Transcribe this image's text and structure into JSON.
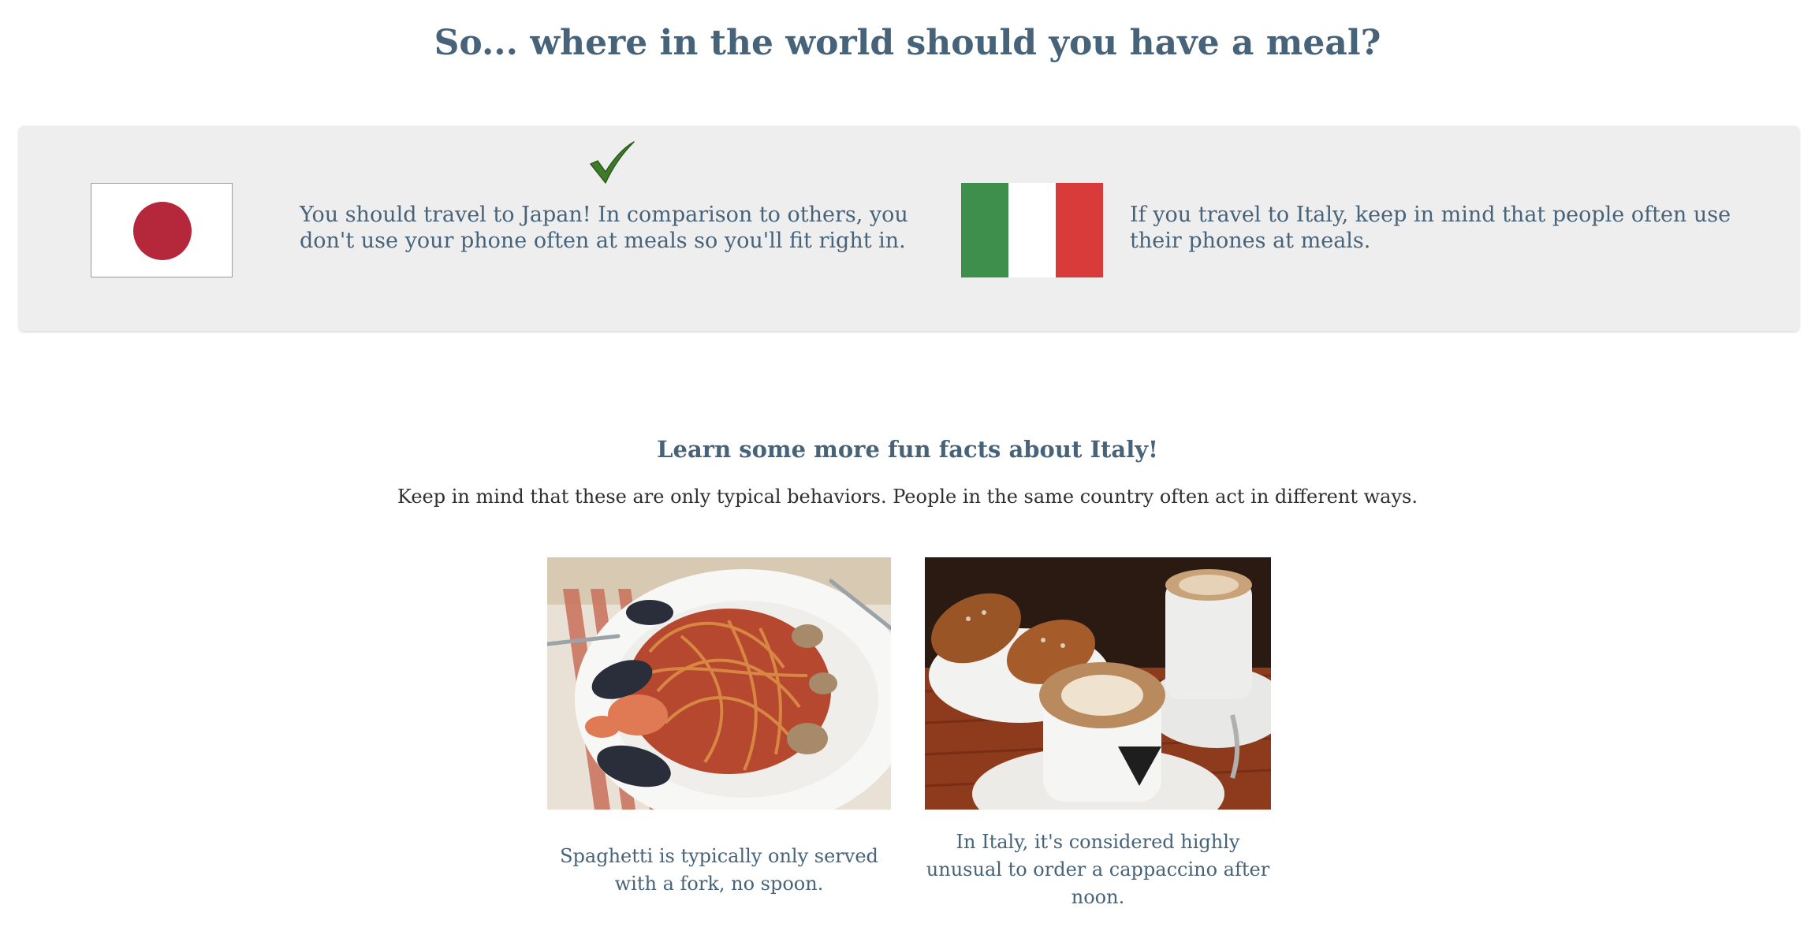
{
  "page": {
    "title": "So... where in the world should you have a meal?"
  },
  "result": {
    "recommended": {
      "country": "Japan",
      "flag_icon": "japan-flag-icon",
      "check_icon": "checkmark-icon",
      "text": "You should travel to Japan! In comparison to others, you don't use your phone often at meals so you'll fit right in."
    },
    "other": {
      "country": "Italy",
      "flag_icon": "italy-flag-icon",
      "text": "If you travel to Italy, keep in mind that people often use their phones at meals."
    }
  },
  "facts": {
    "title": "Learn some more fun facts about Italy!",
    "subtitle": "Keep in mind that these are only typical behaviors. People in the same country often act in different ways.",
    "items": [
      {
        "photo_icon": "spaghetti-photo",
        "caption": "Spaghetti is typically only served with a fork, no spoon."
      },
      {
        "photo_icon": "cappuccino-photo",
        "caption": "In Italy, it's considered highly unusual to order a cappaccino after noon."
      }
    ]
  },
  "colors": {
    "heading": "#46637a",
    "panel_background": "#eeeeee",
    "check": "#3f7a2a",
    "japan_red": "#b5273a",
    "italy_green": "#3e8f4c",
    "italy_white": "#ffffff",
    "italy_red": "#d93a3a"
  }
}
